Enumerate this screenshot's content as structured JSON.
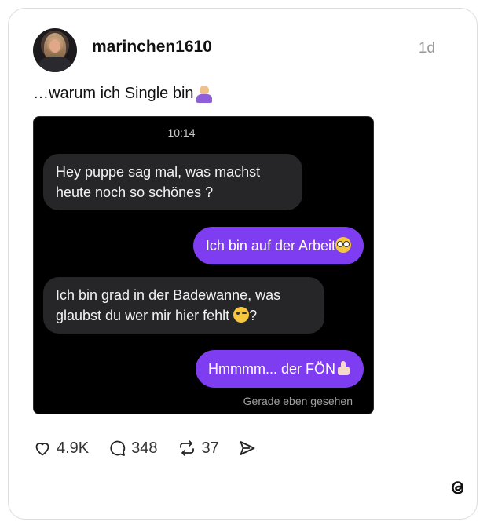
{
  "post": {
    "username": "marinchen1610",
    "time": "1d",
    "caption": "…warum ich Single bin",
    "caption_emoji": "person-shrugging-emoji"
  },
  "screenshot": {
    "time": "10:14",
    "messages": [
      {
        "side": "incoming",
        "text": "Hey puppe sag mal, was machst heute noch so schönes ?"
      },
      {
        "side": "outgoing",
        "text": "Ich bin auf der Arbeit",
        "emoji": "flushed-face-emoji"
      },
      {
        "side": "incoming",
        "text": "Ich bin grad in der Badewanne, was glaubst du wer mir hier fehlt ",
        "emoji": "winking-face-emoji",
        "suffix": "?"
      },
      {
        "side": "outgoing",
        "text": "Hmmmm... der FÖN",
        "emoji": "thumbs-up-emoji"
      }
    ],
    "seen_status": "Gerade eben gesehen"
  },
  "actions": {
    "likes": "4.9K",
    "comments": "348",
    "reposts": "37"
  },
  "icons": {
    "like": "heart-icon",
    "comment": "comment-bubble-icon",
    "repost": "repost-icon",
    "share": "send-icon",
    "brand": "threads-logo-icon"
  },
  "colors": {
    "outgoing_bubble": "#7f3df2",
    "incoming_bubble": "#262628",
    "chat_background": "#000000"
  }
}
